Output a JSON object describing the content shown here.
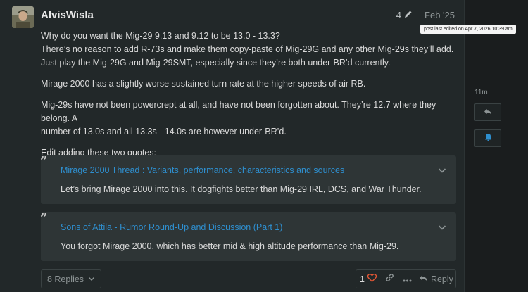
{
  "post": {
    "username": "AlvisWisla",
    "edit_count": "4",
    "date": "Feb '25",
    "tooltip": "post last edited on Apr 7, 2026 10:39 am",
    "paragraphs": [
      [
        "Why do you want the Mig-29 9.13 and 9.12 to be 13.0 - 13.3?",
        "There’s no reason to add R-73s and make them copy-paste of Mig-29G and any other Mig-29s they’ll add.",
        "Just play the Mig-29G and Mig-29SMT, especially since they’re both under-BR’d currently."
      ],
      [
        "Mirage 2000 has a slightly worse sustained turn rate at the higher speeds of air RB."
      ],
      [
        "Mig-29s have not been powercrept at all, and have not been forgotten about. They’re 12.7 where they belong. A",
        "number of 13.0s and all 13.3s - 14.0s are however under-BR’d."
      ],
      [
        "Edit adding these two quotes:"
      ]
    ],
    "quotes": [
      {
        "title": "Mirage 2000 Thread : Variants, performance, characteristics and sources",
        "text": "Let’s bring Mirage 2000 into this. It dogfights better than Mig-29 IRL, DCS, and War Thunder."
      },
      {
        "title": "Sons of Attila - Rumor Round-Up and Discussion (Part 1)",
        "text": "You forgot Mirage 2000, which has better mid & high altitude performance than Mig-29."
      }
    ],
    "replies_label": "8 Replies",
    "like_count": "1",
    "reply_label": "Reply"
  },
  "timeline": {
    "time": "11m"
  },
  "icons": {
    "edit": "pencil-icon",
    "like": "heart-icon",
    "link": "link-icon",
    "more": "ellipsis-icon",
    "reply": "reply-icon",
    "chevron": "chevron-down-icon",
    "bell": "bell-icon"
  },
  "colors": {
    "link": "#2e8fcf",
    "like": "#e45735",
    "timeline_accent": "#c0392b"
  }
}
